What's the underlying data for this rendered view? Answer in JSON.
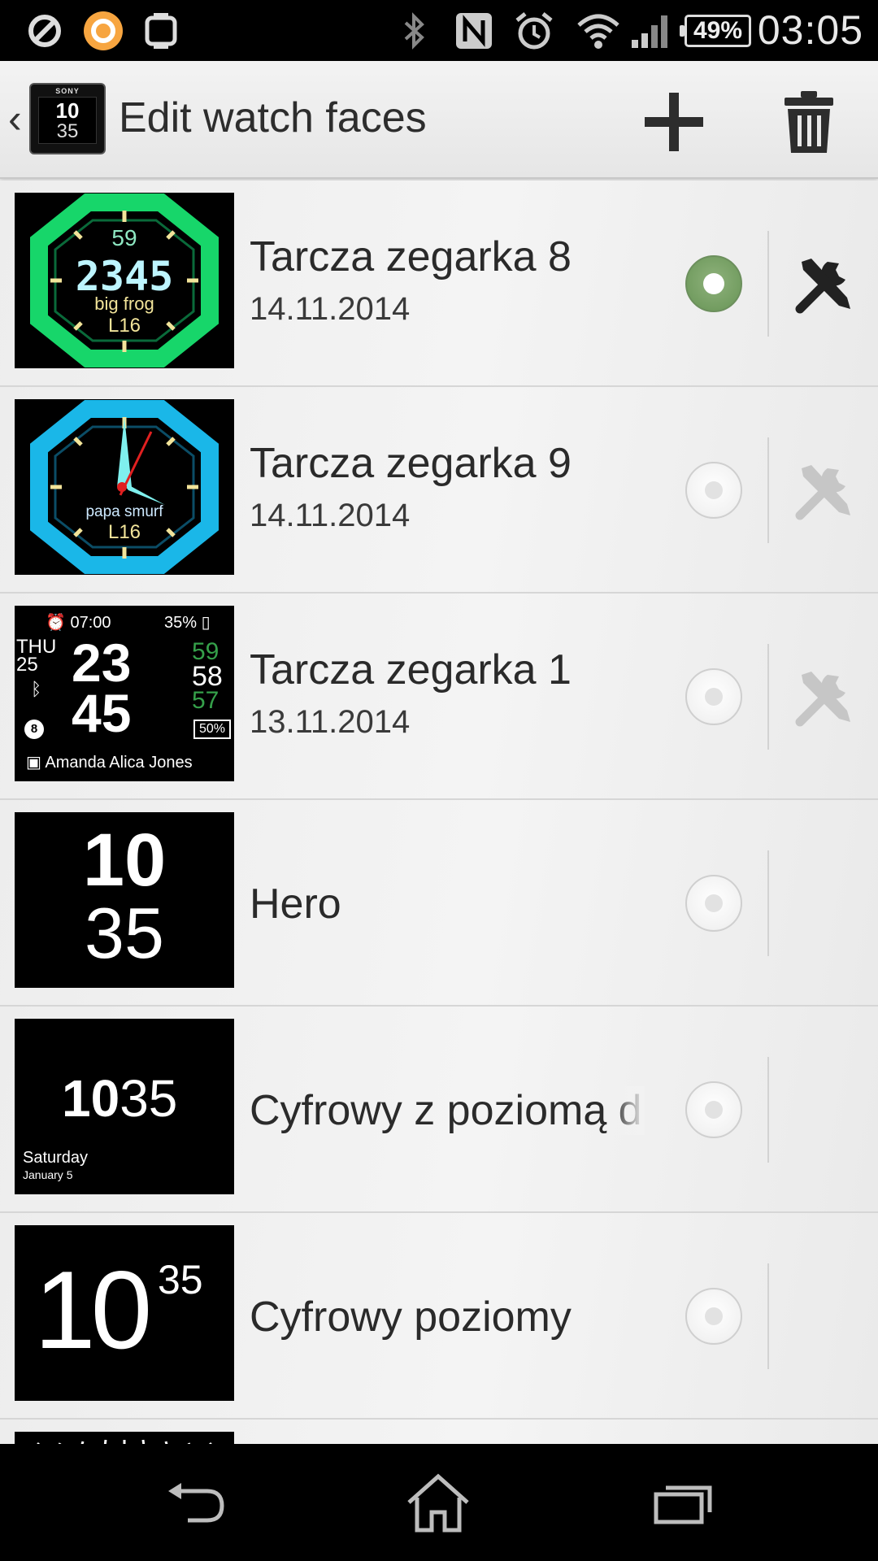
{
  "status_bar": {
    "time": "03:05",
    "battery": "49%",
    "icons": [
      "no-disturb-icon",
      "app-notification-icon",
      "watch-icon",
      "bluetooth-icon",
      "nfc-icon",
      "alarm-icon",
      "wifi-icon",
      "signal-icon",
      "battery-icon"
    ]
  },
  "action_bar": {
    "title": "Edit watch faces",
    "app_icon": {
      "brand": "SONY",
      "hour": "10",
      "minute": "35"
    },
    "add_icon": "plus-icon",
    "delete_icon": "trash-icon"
  },
  "watch_faces": [
    {
      "title": "Tarcza zegarka 8",
      "date": "14.11.2014",
      "selected": true,
      "has_settings": true,
      "settings_enabled": true,
      "thumb": {
        "top": "59",
        "time": "2345",
        "label": "big frog",
        "bottom": "L16"
      }
    },
    {
      "title": "Tarcza zegarka 9",
      "date": "14.11.2014",
      "selected": false,
      "has_settings": true,
      "settings_enabled": false,
      "thumb": {
        "label": "papa smurf",
        "bottom": "L16"
      }
    },
    {
      "title": "Tarcza zegarka 1",
      "date": "13.11.2014",
      "selected": false,
      "has_settings": true,
      "settings_enabled": false,
      "thumb": {
        "alarm": "07:00",
        "battery": "35%",
        "day": "THU",
        "daynum": "25",
        "hour": "23",
        "minute": "45",
        "sec1": "59",
        "sec2": "58",
        "sec3": "57",
        "badge": "8",
        "pct": "50%",
        "contact": "Amanda Alica Jones"
      }
    },
    {
      "title": "Hero",
      "selected": false,
      "has_settings": false,
      "thumb": {
        "hour": "10",
        "minute": "35"
      }
    },
    {
      "title": "Cyfrowy z poziomą d",
      "selected": false,
      "has_settings": false,
      "thumb": {
        "hour": "10",
        "minute": "35",
        "day": "Saturday",
        "date": "January 5"
      }
    },
    {
      "title": "Cyfrowy poziomy",
      "selected": false,
      "has_settings": false,
      "thumb": {
        "hour": "10",
        "minute": "35"
      }
    }
  ],
  "colors": {
    "selected_radio": "#6f9a5d",
    "face8_green": "#17d66a",
    "face9_blue": "#1ab7e8",
    "accent_yellow": "#f2e49a"
  },
  "nav_bar": {
    "back_icon": "back-icon",
    "home_icon": "home-icon",
    "recents_icon": "recents-icon"
  }
}
